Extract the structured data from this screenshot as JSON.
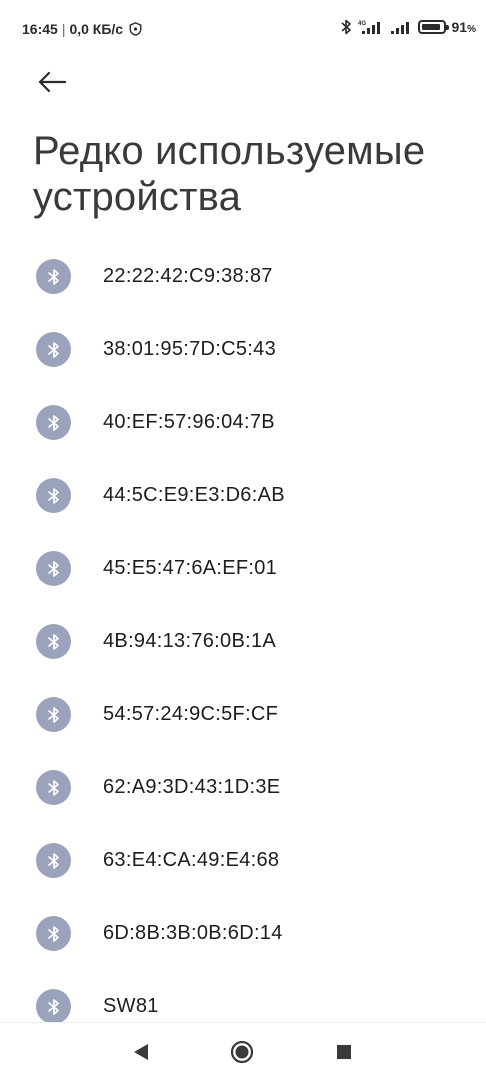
{
  "status_bar": {
    "time": "16:45",
    "separator": "|",
    "speed": "0,0 КБ/с",
    "network_label": "4G",
    "battery_percent": "91",
    "battery_symbol": "%",
    "battery_level": 0.91
  },
  "header": {
    "back_icon": "arrow-left-icon",
    "title": "Редко используемые устройства"
  },
  "devices": [
    {
      "name": "22:22:42:C9:38:87",
      "icon": "bluetooth-icon"
    },
    {
      "name": "38:01:95:7D:C5:43",
      "icon": "bluetooth-icon"
    },
    {
      "name": "40:EF:57:96:04:7B",
      "icon": "bluetooth-icon"
    },
    {
      "name": "44:5C:E9:E3:D6:AB",
      "icon": "bluetooth-icon"
    },
    {
      "name": "45:E5:47:6A:EF:01",
      "icon": "bluetooth-icon"
    },
    {
      "name": "4B:94:13:76:0B:1A",
      "icon": "bluetooth-icon"
    },
    {
      "name": "54:57:24:9C:5F:CF",
      "icon": "bluetooth-icon"
    },
    {
      "name": "62:A9:3D:43:1D:3E",
      "icon": "bluetooth-icon"
    },
    {
      "name": "63:E4:CA:49:E4:68",
      "icon": "bluetooth-icon"
    },
    {
      "name": "6D:8B:3B:0B:6D:14",
      "icon": "bluetooth-icon"
    },
    {
      "name": "SW81",
      "icon": "bluetooth-icon"
    }
  ],
  "nav_bar": {
    "back": "nav-back-icon",
    "home": "nav-home-icon",
    "recents": "nav-recents-icon"
  },
  "colors": {
    "badge": "#9ba3bc",
    "text": "#1d1d1d",
    "title": "#3a3a3a"
  }
}
